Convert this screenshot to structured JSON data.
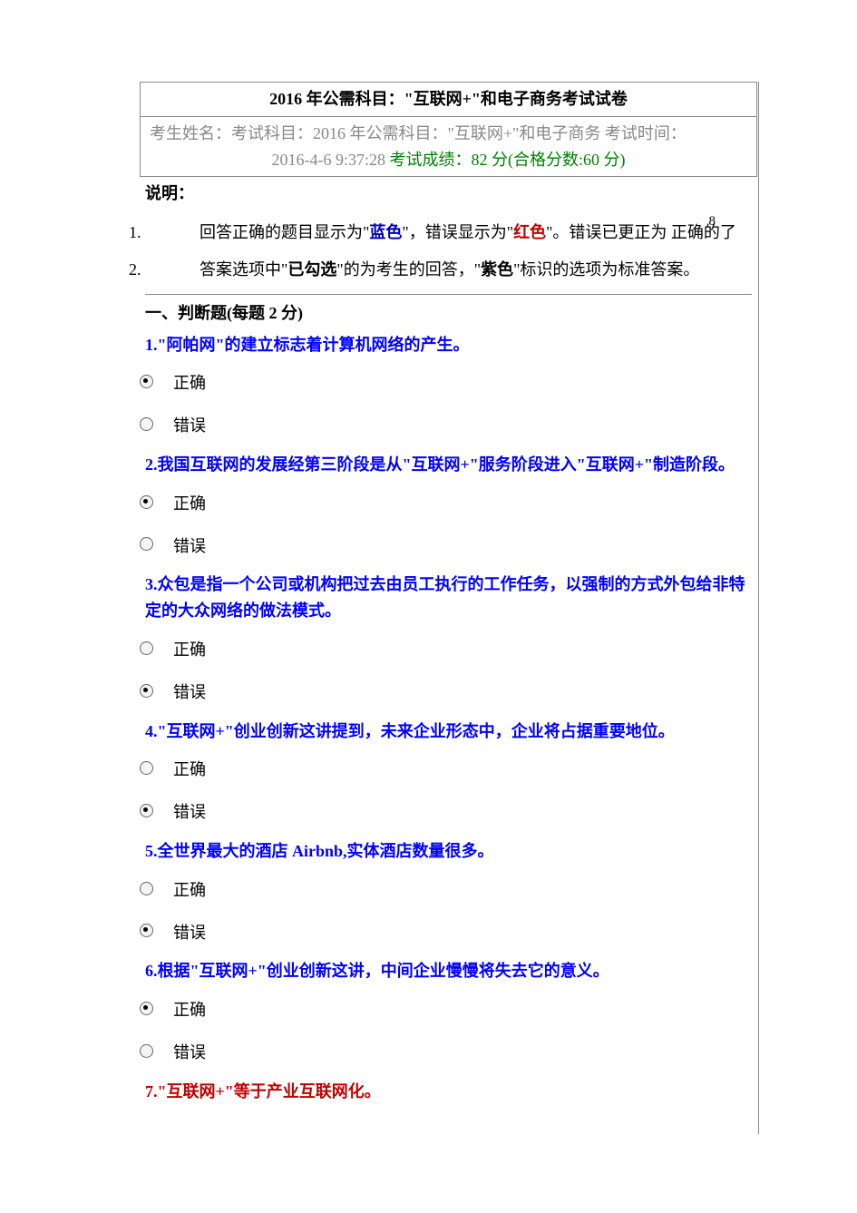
{
  "title": "2016 年公需科目：\"互联网+\"和电子商务考试试卷",
  "info_line1": "考生姓名：考试科目：2016 年公需科目：\"互联网+\"和电子商务  考试时间：",
  "info_line2_prefix": "2016-4-6 9:37:28 ",
  "score_label": "考试成绩：82 分(合格分数:60 分)",
  "desc_heading": "说明：",
  "desc_items": [
    {
      "pre": "回答正确的题目显示为\"",
      "em1": "蓝色",
      "mid": "\"，错误显示为\"",
      "em2": "红色",
      "post": "\"。错误已更正为 正确的了"
    },
    {
      "pre": "答案选项中\"",
      "em1": "已勾选",
      "mid": "\"的为考生的回答，\"",
      "em2": "紫色",
      "post": "\"标识的选项为标准答案。"
    }
  ],
  "page_number": "8",
  "section_heading": "一、判断题(每题 2 分)",
  "option_true": "正确",
  "option_false": "错误",
  "questions": [
    {
      "n": "1.",
      "text": "\"阿帕网\"的建立标志着计算机网络的产生。",
      "status": "blue",
      "selected": "true"
    },
    {
      "n": "2.",
      "text": "我国互联网的发展经第三阶段是从\"互联网+\"服务阶段进入\"互联网+\"制造阶段。",
      "status": "blue",
      "selected": "true"
    },
    {
      "n": "3.",
      "text": "众包是指一个公司或机构把过去由员工执行的工作任务，以强制的方式外包给非特定的大众网络的做法模式。",
      "status": "blue",
      "selected": "false"
    },
    {
      "n": "4.",
      "text": "\"互联网+\"创业创新这讲提到，未来企业形态中，企业将占据重要地位。",
      "status": "blue",
      "selected": "false"
    },
    {
      "n": "5.",
      "text": "全世界最大的酒店 Airbnb,实体酒店数量很多。",
      "status": "blue",
      "selected": "false"
    },
    {
      "n": "6.",
      "text": "根据\"互联网+\"创业创新这讲，中间企业慢慢将失去它的意义。",
      "status": "blue",
      "selected": "true"
    },
    {
      "n": "7.",
      "text": "\"互联网+\"等于产业互联网化。",
      "status": "red",
      "selected": null
    }
  ]
}
